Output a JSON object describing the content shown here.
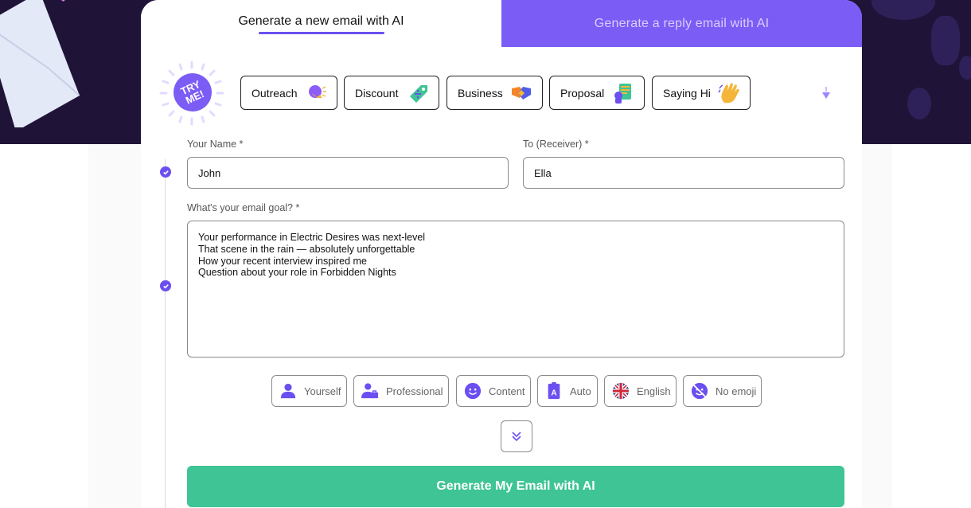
{
  "tabs": {
    "new_email": "Generate a new email with AI",
    "reply_email": "Generate a reply email with AI"
  },
  "tryme": {
    "label": "TRY ME!"
  },
  "templates": [
    {
      "label": "Outreach",
      "icon": "person-speaking-icon"
    },
    {
      "label": "Discount",
      "icon": "price-tag-icon"
    },
    {
      "label": "Business",
      "icon": "handshake-icon"
    },
    {
      "label": "Proposal",
      "icon": "document-icon"
    },
    {
      "label": "Saying Hi",
      "icon": "waving-hand-icon"
    }
  ],
  "form": {
    "name_label": "Your Name *",
    "name_value": "John",
    "receiver_label": "To (Receiver) *",
    "receiver_value": "Ella",
    "goal_label": "What's your email goal? *",
    "goal_lines": [
      "Your performance in Electric Desires was next-level",
      "That scene in the rain — absolutely unforgettable",
      "How your recent interview inspired me",
      "Question about your role in Forbidden Nights"
    ]
  },
  "options": [
    {
      "label": "Yourself",
      "icon": "person-icon"
    },
    {
      "label": "Professional",
      "icon": "professional-icon"
    },
    {
      "label": "Content",
      "icon": "smiley-icon"
    },
    {
      "label": "Auto",
      "icon": "letter-a-icon"
    },
    {
      "label": "English",
      "icon": "uk-flag-icon"
    },
    {
      "label": "No emoji",
      "icon": "no-emoji-icon"
    }
  ],
  "generate_button": "Generate My Email with AI",
  "colors": {
    "accent": "#6c4ff0",
    "tab_inactive": "#7b5cf5",
    "hero_bg": "#1f1438",
    "generate": "#3ec495"
  }
}
